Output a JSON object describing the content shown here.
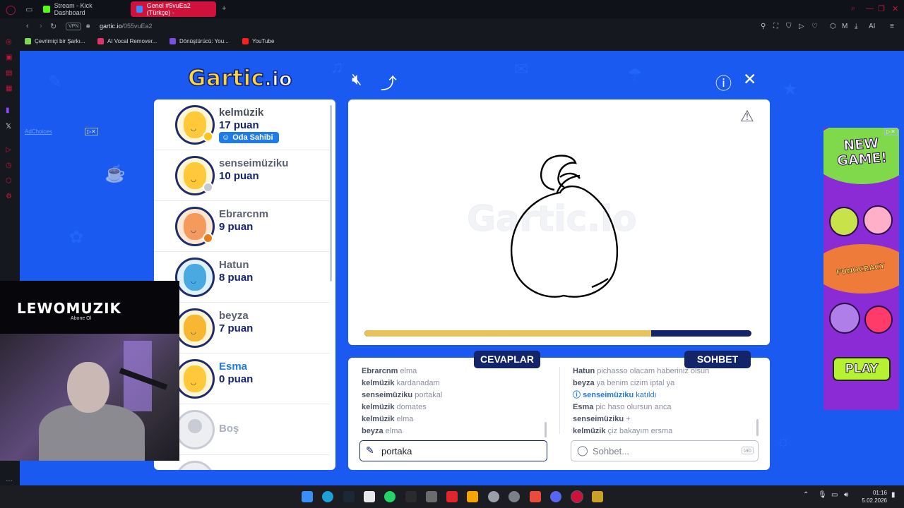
{
  "browser": {
    "tabs": [
      {
        "label": "Stream - Kick Dashboard",
        "active": false
      },
      {
        "label": "Genel #5vuEa2 (Türkçe) -",
        "active": true
      }
    ],
    "vpn": "VPN",
    "url_host": "gartic.io",
    "url_path": "/055vuEa2",
    "ai_label": "AI",
    "bookmarks": [
      "Çevrimiçi bir Şarkı...",
      "AI Vocal Remover...",
      "Dönüştürücü: You...",
      "YouTube"
    ]
  },
  "game": {
    "logo_main": "Gartic",
    "logo_suffix": ".io",
    "watermark": "Gartic.io",
    "timer_progress": 0.74,
    "players": [
      {
        "name": "kelmüzik",
        "points": "17 puan",
        "host_badge": "Oda Sahibi",
        "color": "#ffc93a",
        "dot": "#ffc21a"
      },
      {
        "name": "senseimüziku",
        "points": "10 puan",
        "color": "#ffc93a",
        "dot": "#c5c9d3"
      },
      {
        "name": "Ebrarcnm",
        "points": "9 puan",
        "color": "#f49a5c",
        "dot": "#e87d1e"
      },
      {
        "name": "Hatun",
        "points": "8 puan",
        "color": "#7cc8f0",
        "dot": ""
      },
      {
        "name": "beyza",
        "points": "7 puan",
        "color": "#ffc93a",
        "dot": ""
      },
      {
        "name": "Esma",
        "points": "0 puan",
        "color": "#ffc93a",
        "dot": ""
      }
    ],
    "empty_slot": "Boş",
    "answers_tab": "CEVAPLAR",
    "chat_tab": "SOHBET",
    "answers": [
      {
        "user": "Ebrarcnm",
        "text": "elma"
      },
      {
        "user": "kelmüzik",
        "text": "kardanadam"
      },
      {
        "user": "senseimüziku",
        "text": "portakal"
      },
      {
        "user": "kelmüzik",
        "text": "domates"
      },
      {
        "user": "kelmüzik",
        "text": "elma"
      },
      {
        "user": "beyza",
        "text": "elma"
      }
    ],
    "chat": [
      {
        "user": "Hatun",
        "text": "pichasso olacam haberiniz olsun"
      },
      {
        "user": "beyza",
        "text": "ya benim cizim iptal ya"
      },
      {
        "user": "senseimüziku",
        "text": "katıldı",
        "system": true
      },
      {
        "user": "Esma",
        "text": "pic haso olursun anca"
      },
      {
        "user": "senseimüziku",
        "text": "+"
      },
      {
        "user": "kelmüzik",
        "text": "çiz bakayım ersma"
      }
    ],
    "answer_input_value": "portaka",
    "chat_placeholder": "Sohbet...",
    "tab_key": "tab"
  },
  "ads": {
    "adchoices": "AdChoices",
    "headline": "NEW GAME!",
    "brand": "FUNOCRACY",
    "cta": "PLAY"
  },
  "overlay": {
    "channel": "LEWOMUZIK",
    "subtitle": "Abone Ol"
  },
  "taskbar": {
    "time": "01:16",
    "date": "5.02.2026"
  }
}
